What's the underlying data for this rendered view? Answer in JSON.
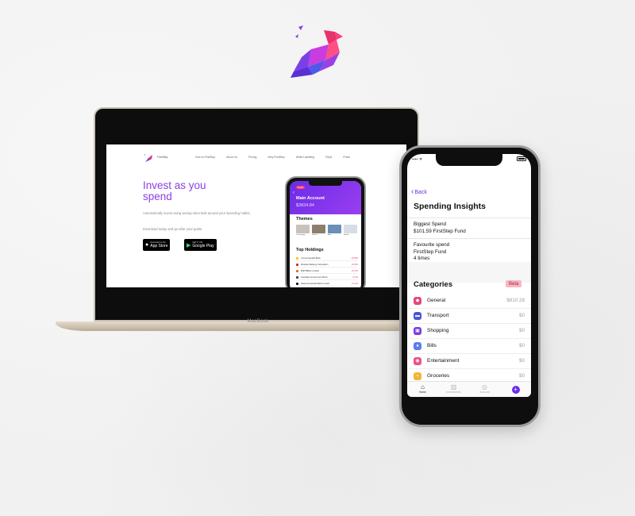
{
  "laptop": {
    "brand_label": "MacBook",
    "site": {
      "brand": "FirstStep",
      "nav": [
        "How to FirstStep",
        "About Us",
        "Pricing",
        "Why FirstStep",
        "White Labelling",
        "FAQs",
        "Press"
      ],
      "hero_title": "Invest as you spend",
      "hero_subtitle": "Automatically invest using saving rules built around your spending habits.",
      "hero_cta": "Download today and go after your goals.",
      "app_store": {
        "small": "Download on the",
        "big": "App Store"
      },
      "google_play": {
        "small": "GET IT ON",
        "big": "Google Play"
      }
    },
    "mini_phone": {
      "badge": "Invest",
      "account_title": "Main Account",
      "balance": "$3834.84",
      "themes_title": "Themes",
      "themes": [
        {
          "label": "Technology",
          "color": "#c7c2bb"
        },
        {
          "label": "Ethical",
          "color": "#8d7e6d"
        },
        {
          "label": "Asia",
          "color": "#6a8fb8"
        },
        {
          "label": "Health",
          "color": "#d8dce4"
        }
      ],
      "holdings_title": "Top Holdings",
      "holdings": [
        {
          "name": "Commonwealth Bank",
          "pct": "25.09%",
          "color": "#f5c400"
        },
        {
          "name": "Westpac Banking Corporation",
          "pct": "18.25%",
          "color": "#d81e2c"
        },
        {
          "name": "BHP Billiton Limited",
          "pct": "15.11%",
          "color": "#e06a1a"
        },
        {
          "name": "Australian Government Bond",
          "pct": "12.1%",
          "color": "#2b3f7a"
        },
        {
          "name": "National Australia Bank Limited",
          "pct": "10.11%",
          "color": "#111111"
        }
      ]
    }
  },
  "phone": {
    "status_time": "12:11 pm",
    "status_left": "•••• ᯤ",
    "back_label": "Back",
    "title": "Spending Insights",
    "insights": [
      {
        "line1": "Biggest Spend",
        "line2": "$101.59 FirstStep Fund"
      },
      {
        "line1": "Favourite spend",
        "line2": "FirstStep Fund",
        "line3": "4 times"
      }
    ],
    "categories_title": "Categories",
    "beta_label": "Beta",
    "categories": [
      {
        "name": "General",
        "amount": "$810.28",
        "color": "#e8457a",
        "icon": "tag-icon",
        "glyph": "◆"
      },
      {
        "name": "Transport",
        "amount": "$0",
        "color": "#4a58d8",
        "icon": "car-icon",
        "glyph": "▬"
      },
      {
        "name": "Shopping",
        "amount": "$0",
        "color": "#7a3be0",
        "icon": "shopping-bag-icon",
        "glyph": "▣"
      },
      {
        "name": "Bills",
        "amount": "$0",
        "color": "#5a7ef0",
        "icon": "lightbulb-icon",
        "glyph": "●"
      },
      {
        "name": "Entertainment",
        "amount": "$0",
        "color": "#ef4f86",
        "icon": "entertainment-icon",
        "glyph": "◉"
      },
      {
        "name": "Groceries",
        "amount": "$0",
        "color": "#f2b43a",
        "icon": "groceries-icon",
        "glyph": "▪"
      }
    ],
    "tabs": [
      {
        "label": "Home",
        "icon": "home-icon",
        "glyph": "⌂",
        "active": true
      },
      {
        "label": "Investments",
        "icon": "investments-icon",
        "glyph": "▥",
        "active": false
      },
      {
        "label": "Account",
        "icon": "account-icon",
        "glyph": "◎",
        "active": false
      }
    ],
    "accent_color": "#6c2fe6"
  }
}
